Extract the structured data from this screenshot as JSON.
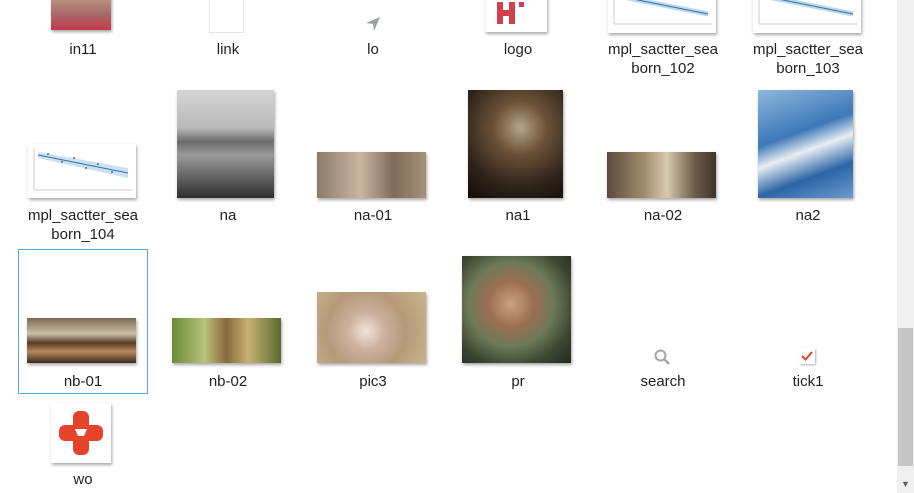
{
  "files": [
    {
      "name": "in11"
    },
    {
      "name": "link"
    },
    {
      "name": "lo"
    },
    {
      "name": "logo"
    },
    {
      "name": "mpl_sactter_sea\nborn_102"
    },
    {
      "name": "mpl_sactter_sea\nborn_103"
    },
    {
      "name": "mpl_sactter_sea\nborn_104"
    },
    {
      "name": "na"
    },
    {
      "name": "na-01"
    },
    {
      "name": "na1"
    },
    {
      "name": "na-02"
    },
    {
      "name": "na2"
    },
    {
      "name": "nb-01"
    },
    {
      "name": "nb-02"
    },
    {
      "name": "pic3"
    },
    {
      "name": "pr"
    },
    {
      "name": "search"
    },
    {
      "name": "tick1"
    },
    {
      "name": "wo"
    }
  ],
  "selected": "nb-01",
  "colors": {
    "selection_border": "#5aa7e8",
    "accent_red": "#e5432a"
  }
}
